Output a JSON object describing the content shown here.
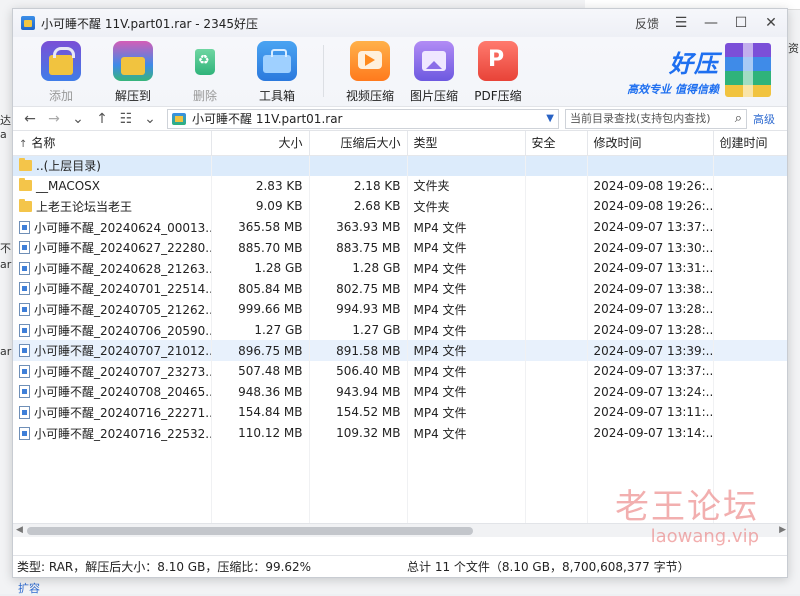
{
  "window": {
    "title": "小可睡不醒 11V.part01.rar - 2345好压"
  },
  "titlebar": {
    "feedback": "反馈",
    "menu": "☰",
    "minimize": "—",
    "maximize": "☐",
    "close": "✕"
  },
  "toolbar": {
    "add": "添加",
    "extract": "解压到",
    "delete": "删除",
    "tools": "工具箱",
    "video": "视频压缩",
    "image": "图片压缩",
    "pdf": "PDF压缩"
  },
  "brand": {
    "title": "好压",
    "slogan": "高效专业  值得信赖"
  },
  "navbar": {
    "address": "小可睡不醒 11V.part01.rar",
    "search_placeholder": "当前目录查找(支持包内查找)",
    "advanced": "高级"
  },
  "table": {
    "headers": {
      "name": "名称",
      "size": "大小",
      "packed": "压缩后大小",
      "type": "类型",
      "security": "安全",
      "modified": "修改时间",
      "created": "创建时间"
    },
    "rows": [
      {
        "name": "..(上层目录)",
        "size": "",
        "packed": "",
        "type": "",
        "modified": ""
      },
      {
        "name": "__MACOSX",
        "size": "2.83 KB",
        "packed": "2.18 KB",
        "type": "文件夹",
        "modified": "2024-09-08 19:26:..."
      },
      {
        "name": "上老王论坛当老王",
        "size": "9.09 KB",
        "packed": "2.68 KB",
        "type": "文件夹",
        "modified": "2024-09-08 19:26:..."
      },
      {
        "name": "小可睡不醒_20240624_00013...",
        "size": "365.58 MB",
        "packed": "363.93 MB",
        "type": "MP4 文件",
        "modified": "2024-09-07 13:37:..."
      },
      {
        "name": "小可睡不醒_20240627_22280...",
        "size": "885.70 MB",
        "packed": "883.75 MB",
        "type": "MP4 文件",
        "modified": "2024-09-07 13:30:..."
      },
      {
        "name": "小可睡不醒_20240628_21263...",
        "size": "1.28 GB",
        "packed": "1.28 GB",
        "type": "MP4 文件",
        "modified": "2024-09-07 13:31:..."
      },
      {
        "name": "小可睡不醒_20240701_22514...",
        "size": "805.84 MB",
        "packed": "802.75 MB",
        "type": "MP4 文件",
        "modified": "2024-09-07 13:38:..."
      },
      {
        "name": "小可睡不醒_20240705_21262...",
        "size": "999.66 MB",
        "packed": "994.93 MB",
        "type": "MP4 文件",
        "modified": "2024-09-07 13:28:..."
      },
      {
        "name": "小可睡不醒_20240706_20590...",
        "size": "1.27 GB",
        "packed": "1.27 GB",
        "type": "MP4 文件",
        "modified": "2024-09-07 13:28:..."
      },
      {
        "name": "小可睡不醒_20240707_21012...",
        "size": "896.75 MB",
        "packed": "891.58 MB",
        "type": "MP4 文件",
        "modified": "2024-09-07 13:39:..."
      },
      {
        "name": "小可睡不醒_20240707_23273...",
        "size": "507.48 MB",
        "packed": "506.40 MB",
        "type": "MP4 文件",
        "modified": "2024-09-07 13:37:..."
      },
      {
        "name": "小可睡不醒_20240708_20465...",
        "size": "948.36 MB",
        "packed": "943.94 MB",
        "type": "MP4 文件",
        "modified": "2024-09-07 13:24:..."
      },
      {
        "name": "小可睡不醒_20240716_22271...",
        "size": "154.84 MB",
        "packed": "154.52 MB",
        "type": "MP4 文件",
        "modified": "2024-09-07 13:11:..."
      },
      {
        "name": "小可睡不醒_20240716_22532...",
        "size": "110.12 MB",
        "packed": "109.32 MB",
        "type": "MP4 文件",
        "modified": "2024-09-07 13:14:..."
      }
    ]
  },
  "status": {
    "left": "类型: RAR，解压后大小：8.10 GB，压缩比：99.62%",
    "right": "总计 11 个文件（8.10 GB，8,700,608,377 字节）"
  },
  "watermark": {
    "big": "老王论坛",
    "small": "laowang.vip"
  },
  "background": {
    "bottom_link": "扩容"
  }
}
